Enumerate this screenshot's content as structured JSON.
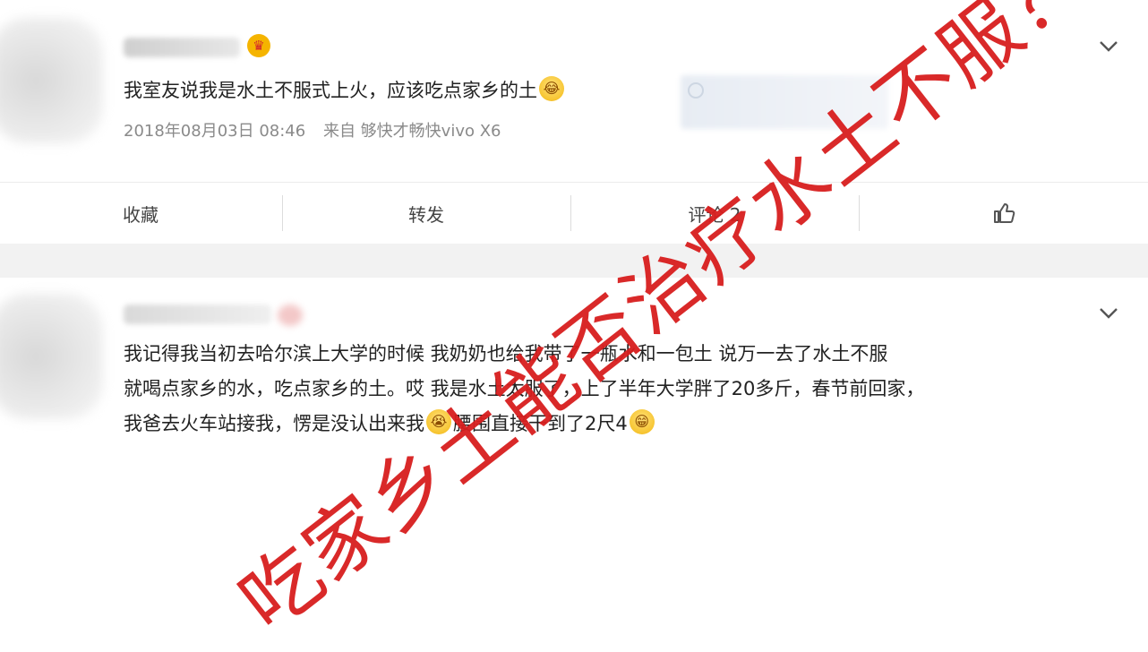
{
  "post1": {
    "author_blurred": "",
    "content": "我室友说我是水土不服式上火，应该吃点家乡的土",
    "emoji": "laughing-tears",
    "time": "2018年08月03日 08:46",
    "source": "来自 够快才畅快vivo X6",
    "actions": {
      "favorite": "收藏",
      "repost": "转发",
      "comment": "评论 2",
      "like_icon": "thumbs-up-icon"
    }
  },
  "post2": {
    "line1": "我记得我当初去哈尔滨上大学的时候 我奶奶也给我带了一瓶水和一包土 说万一去了水土不服",
    "line2": "就喝点家乡的水，吃点家乡的土。哎 我是水土太服了，上了半年大学胖了20多斤，春节前回家，",
    "line3a": "我爸去火车站接我，愣是没认出来我",
    "line3b": "腰围直接干到了2尺4",
    "emoji1": "crying-laughing",
    "emoji2": "grinning"
  },
  "watermark": "吃家乡土能否治疗水土不服？",
  "colors": {
    "watermark": "#d81e1e",
    "meta": "#8a8a8a",
    "crown": "#f5b400"
  }
}
